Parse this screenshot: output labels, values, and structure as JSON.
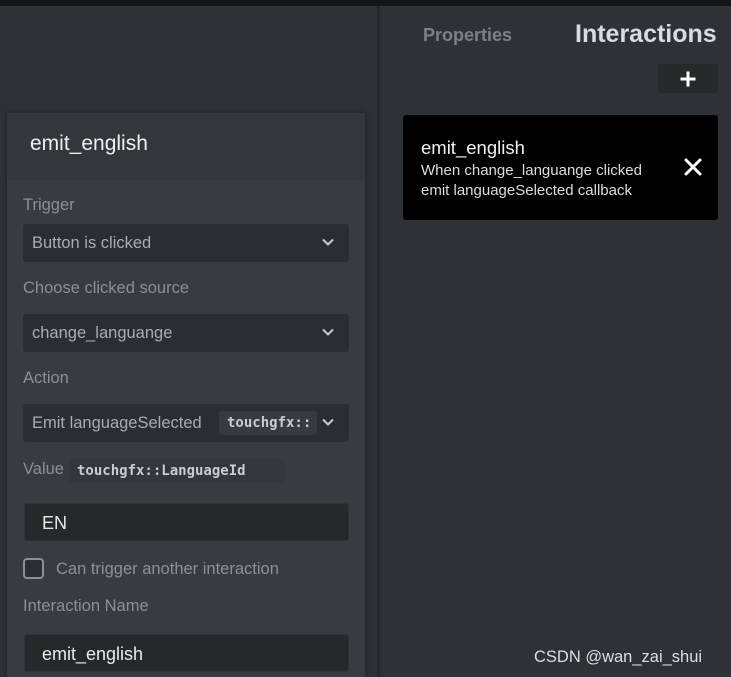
{
  "tabs": {
    "properties": "Properties",
    "interactions": "Interactions"
  },
  "add_button": {
    "icon": "plus-icon",
    "label": "+"
  },
  "editor": {
    "title": "emit_english",
    "trigger": {
      "label": "Trigger",
      "value": "Button is clicked"
    },
    "source": {
      "label": "Choose clicked source",
      "value": "change_languange"
    },
    "action": {
      "label": "Action",
      "value": "Emit languageSelected",
      "type_chip": "touchgfx::"
    },
    "value": {
      "label": "Value",
      "type_chip": "touchgfx::LanguageId",
      "input": "EN"
    },
    "can_trigger": {
      "label": "Can trigger another interaction",
      "checked": false
    },
    "interaction_name": {
      "label": "Interaction Name",
      "input": "emit_english"
    }
  },
  "interactions": [
    {
      "name": "emit_english",
      "line1": "When change_languange clicked",
      "line2": "emit languageSelected callback",
      "remove_icon": "close-icon"
    }
  ],
  "watermark": "CSDN @wan_zai_shui",
  "colors": {
    "background": "#2e3135",
    "card": "#383b40",
    "input": "#26292c",
    "interaction_card": "#000000",
    "muted_text": "#8c9095"
  }
}
